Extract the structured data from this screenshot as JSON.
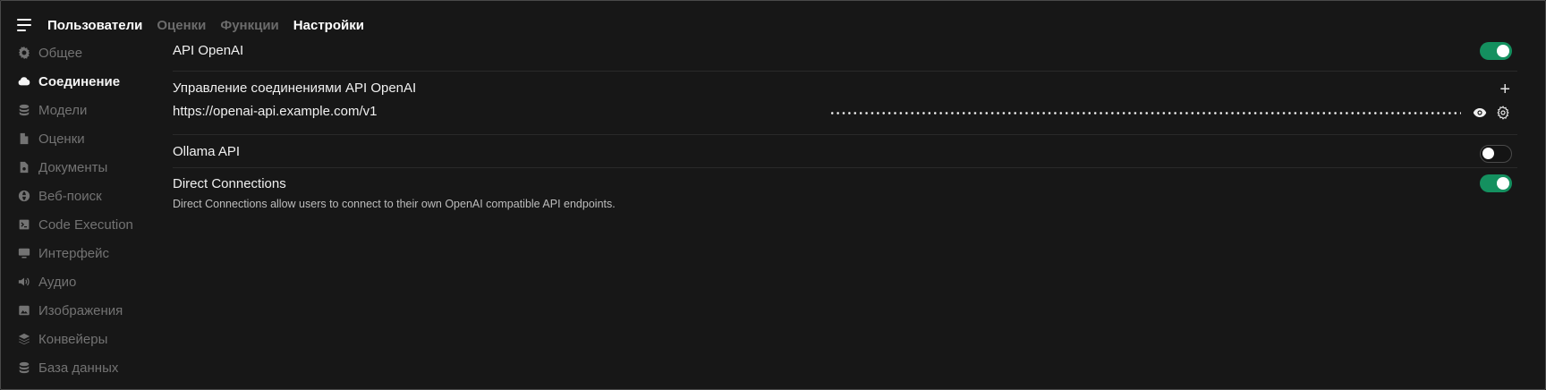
{
  "nav": {
    "tabs": [
      {
        "label": "Пользователи",
        "active": true
      },
      {
        "label": "Оценки",
        "active": false
      },
      {
        "label": "Функции",
        "active": false
      },
      {
        "label": "Настройки",
        "active": true
      }
    ]
  },
  "sidebar": {
    "items": [
      {
        "label": "Общее",
        "icon": "gear-icon",
        "active": false
      },
      {
        "label": "Соединение",
        "icon": "cloud-icon",
        "active": true
      },
      {
        "label": "Модели",
        "icon": "database-icon",
        "active": false
      },
      {
        "label": "Оценки",
        "icon": "document-icon",
        "active": false
      },
      {
        "label": "Документы",
        "icon": "document-search-icon",
        "active": false
      },
      {
        "label": "Веб-поиск",
        "icon": "globe-icon",
        "active": false
      },
      {
        "label": "Code Execution",
        "icon": "terminal-icon",
        "active": false
      },
      {
        "label": "Интерфейс",
        "icon": "monitor-icon",
        "active": false
      },
      {
        "label": "Аудио",
        "icon": "speaker-icon",
        "active": false
      },
      {
        "label": "Изображения",
        "icon": "image-icon",
        "active": false
      },
      {
        "label": "Конвейеры",
        "icon": "layers-icon",
        "active": false
      },
      {
        "label": "База данных",
        "icon": "database-icon",
        "active": false
      }
    ]
  },
  "main": {
    "openai": {
      "label": "API OpenAI",
      "enabled": true
    },
    "manage": {
      "label": "Управление соединениями API OpenAI"
    },
    "connection": {
      "url": "https://openai-api.example.com/v1",
      "key_masked": true
    },
    "ollama": {
      "label": "Ollama API",
      "enabled": false
    },
    "direct": {
      "label": "Direct Connections",
      "enabled": true,
      "description": "Direct Connections allow users to connect to their own OpenAI compatible API endpoints."
    }
  },
  "colors": {
    "toggle_on": "#14905f",
    "background": "#171717"
  }
}
